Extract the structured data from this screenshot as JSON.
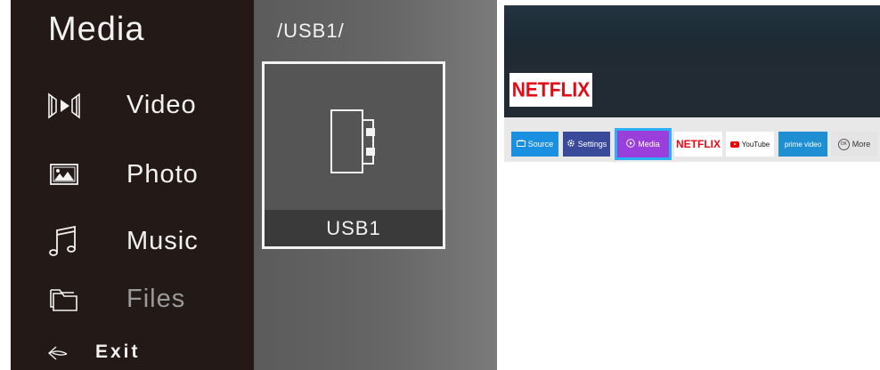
{
  "media_menu": {
    "title": "Media",
    "items": [
      {
        "label": "Video",
        "icon": "video-icon"
      },
      {
        "label": "Photo",
        "icon": "photo-icon"
      },
      {
        "label": "Music",
        "icon": "music-icon"
      },
      {
        "label": "Files",
        "icon": "files-icon"
      }
    ],
    "exit_label": "Exit",
    "exit_icon": "exit-arrow-icon"
  },
  "browser": {
    "path": "/USB1/",
    "selected_item": {
      "label": "USB1",
      "icon": "usb-drive-icon"
    }
  },
  "tv_home": {
    "featured_app": "NETFLIX",
    "apps": [
      {
        "label": "Source",
        "icon": "source-icon"
      },
      {
        "label": "Settings",
        "icon": "gear-icon"
      },
      {
        "label": "Media",
        "icon": "play-circle-icon",
        "selected": true
      },
      {
        "label": "NETFLIX"
      },
      {
        "label": "YouTube",
        "icon": "youtube-icon"
      },
      {
        "label": "prime video"
      },
      {
        "label": "More",
        "icon": "ok-icon"
      }
    ]
  },
  "colors": {
    "sidebar_bg": "#231a18",
    "browser_bg": "#666666",
    "netflix_red": "#e50914",
    "media_tile": "#9b3fdc",
    "focus_border": "#2bb0f5"
  }
}
